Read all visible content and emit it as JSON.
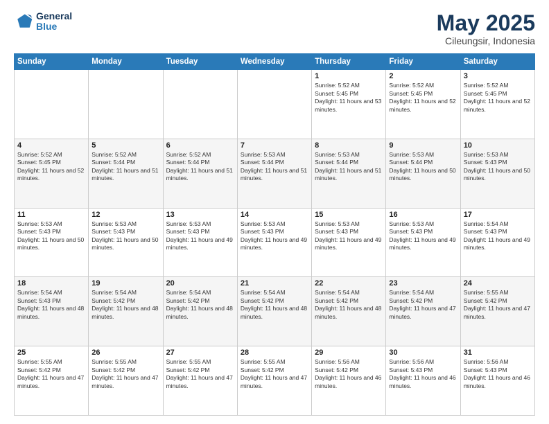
{
  "header": {
    "logo_line1": "General",
    "logo_line2": "Blue",
    "title": "May 2025",
    "subtitle": "Cileungsir, Indonesia"
  },
  "columns": [
    "Sunday",
    "Monday",
    "Tuesday",
    "Wednesday",
    "Thursday",
    "Friday",
    "Saturday"
  ],
  "weeks": [
    [
      {
        "day": "",
        "sunrise": "",
        "sunset": "",
        "daylight": ""
      },
      {
        "day": "",
        "sunrise": "",
        "sunset": "",
        "daylight": ""
      },
      {
        "day": "",
        "sunrise": "",
        "sunset": "",
        "daylight": ""
      },
      {
        "day": "",
        "sunrise": "",
        "sunset": "",
        "daylight": ""
      },
      {
        "day": "1",
        "sunrise": "Sunrise: 5:52 AM",
        "sunset": "Sunset: 5:45 PM",
        "daylight": "Daylight: 11 hours and 53 minutes."
      },
      {
        "day": "2",
        "sunrise": "Sunrise: 5:52 AM",
        "sunset": "Sunset: 5:45 PM",
        "daylight": "Daylight: 11 hours and 52 minutes."
      },
      {
        "day": "3",
        "sunrise": "Sunrise: 5:52 AM",
        "sunset": "Sunset: 5:45 PM",
        "daylight": "Daylight: 11 hours and 52 minutes."
      }
    ],
    [
      {
        "day": "4",
        "sunrise": "Sunrise: 5:52 AM",
        "sunset": "Sunset: 5:45 PM",
        "daylight": "Daylight: 11 hours and 52 minutes."
      },
      {
        "day": "5",
        "sunrise": "Sunrise: 5:52 AM",
        "sunset": "Sunset: 5:44 PM",
        "daylight": "Daylight: 11 hours and 51 minutes."
      },
      {
        "day": "6",
        "sunrise": "Sunrise: 5:52 AM",
        "sunset": "Sunset: 5:44 PM",
        "daylight": "Daylight: 11 hours and 51 minutes."
      },
      {
        "day": "7",
        "sunrise": "Sunrise: 5:53 AM",
        "sunset": "Sunset: 5:44 PM",
        "daylight": "Daylight: 11 hours and 51 minutes."
      },
      {
        "day": "8",
        "sunrise": "Sunrise: 5:53 AM",
        "sunset": "Sunset: 5:44 PM",
        "daylight": "Daylight: 11 hours and 51 minutes."
      },
      {
        "day": "9",
        "sunrise": "Sunrise: 5:53 AM",
        "sunset": "Sunset: 5:44 PM",
        "daylight": "Daylight: 11 hours and 50 minutes."
      },
      {
        "day": "10",
        "sunrise": "Sunrise: 5:53 AM",
        "sunset": "Sunset: 5:43 PM",
        "daylight": "Daylight: 11 hours and 50 minutes."
      }
    ],
    [
      {
        "day": "11",
        "sunrise": "Sunrise: 5:53 AM",
        "sunset": "Sunset: 5:43 PM",
        "daylight": "Daylight: 11 hours and 50 minutes."
      },
      {
        "day": "12",
        "sunrise": "Sunrise: 5:53 AM",
        "sunset": "Sunset: 5:43 PM",
        "daylight": "Daylight: 11 hours and 50 minutes."
      },
      {
        "day": "13",
        "sunrise": "Sunrise: 5:53 AM",
        "sunset": "Sunset: 5:43 PM",
        "daylight": "Daylight: 11 hours and 49 minutes."
      },
      {
        "day": "14",
        "sunrise": "Sunrise: 5:53 AM",
        "sunset": "Sunset: 5:43 PM",
        "daylight": "Daylight: 11 hours and 49 minutes."
      },
      {
        "day": "15",
        "sunrise": "Sunrise: 5:53 AM",
        "sunset": "Sunset: 5:43 PM",
        "daylight": "Daylight: 11 hours and 49 minutes."
      },
      {
        "day": "16",
        "sunrise": "Sunrise: 5:53 AM",
        "sunset": "Sunset: 5:43 PM",
        "daylight": "Daylight: 11 hours and 49 minutes."
      },
      {
        "day": "17",
        "sunrise": "Sunrise: 5:54 AM",
        "sunset": "Sunset: 5:43 PM",
        "daylight": "Daylight: 11 hours and 49 minutes."
      }
    ],
    [
      {
        "day": "18",
        "sunrise": "Sunrise: 5:54 AM",
        "sunset": "Sunset: 5:43 PM",
        "daylight": "Daylight: 11 hours and 48 minutes."
      },
      {
        "day": "19",
        "sunrise": "Sunrise: 5:54 AM",
        "sunset": "Sunset: 5:42 PM",
        "daylight": "Daylight: 11 hours and 48 minutes."
      },
      {
        "day": "20",
        "sunrise": "Sunrise: 5:54 AM",
        "sunset": "Sunset: 5:42 PM",
        "daylight": "Daylight: 11 hours and 48 minutes."
      },
      {
        "day": "21",
        "sunrise": "Sunrise: 5:54 AM",
        "sunset": "Sunset: 5:42 PM",
        "daylight": "Daylight: 11 hours and 48 minutes."
      },
      {
        "day": "22",
        "sunrise": "Sunrise: 5:54 AM",
        "sunset": "Sunset: 5:42 PM",
        "daylight": "Daylight: 11 hours and 48 minutes."
      },
      {
        "day": "23",
        "sunrise": "Sunrise: 5:54 AM",
        "sunset": "Sunset: 5:42 PM",
        "daylight": "Daylight: 11 hours and 47 minutes."
      },
      {
        "day": "24",
        "sunrise": "Sunrise: 5:55 AM",
        "sunset": "Sunset: 5:42 PM",
        "daylight": "Daylight: 11 hours and 47 minutes."
      }
    ],
    [
      {
        "day": "25",
        "sunrise": "Sunrise: 5:55 AM",
        "sunset": "Sunset: 5:42 PM",
        "daylight": "Daylight: 11 hours and 47 minutes."
      },
      {
        "day": "26",
        "sunrise": "Sunrise: 5:55 AM",
        "sunset": "Sunset: 5:42 PM",
        "daylight": "Daylight: 11 hours and 47 minutes."
      },
      {
        "day": "27",
        "sunrise": "Sunrise: 5:55 AM",
        "sunset": "Sunset: 5:42 PM",
        "daylight": "Daylight: 11 hours and 47 minutes."
      },
      {
        "day": "28",
        "sunrise": "Sunrise: 5:55 AM",
        "sunset": "Sunset: 5:42 PM",
        "daylight": "Daylight: 11 hours and 47 minutes."
      },
      {
        "day": "29",
        "sunrise": "Sunrise: 5:56 AM",
        "sunset": "Sunset: 5:42 PM",
        "daylight": "Daylight: 11 hours and 46 minutes."
      },
      {
        "day": "30",
        "sunrise": "Sunrise: 5:56 AM",
        "sunset": "Sunset: 5:43 PM",
        "daylight": "Daylight: 11 hours and 46 minutes."
      },
      {
        "day": "31",
        "sunrise": "Sunrise: 5:56 AM",
        "sunset": "Sunset: 5:43 PM",
        "daylight": "Daylight: 11 hours and 46 minutes."
      }
    ]
  ]
}
